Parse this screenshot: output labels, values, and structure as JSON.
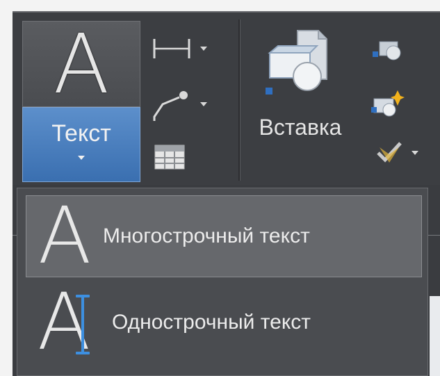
{
  "ribbon": {
    "text_button": {
      "label": "Текст",
      "icon": "large-letter-a-icon",
      "glyph": "A"
    },
    "tools": [
      {
        "name": "dimension",
        "icon": "linear-dimension-icon"
      },
      {
        "name": "leader",
        "icon": "leader-icon"
      },
      {
        "name": "table",
        "icon": "table-icon"
      }
    ],
    "insert_button": {
      "label": "Вставка",
      "icon": "insert-block-icon"
    },
    "block_tools": [
      {
        "name": "create-block",
        "icon": "create-block-icon"
      },
      {
        "name": "edit-block",
        "icon": "edit-block-icon"
      },
      {
        "name": "block-attributes",
        "icon": "block-attributes-icon"
      }
    ]
  },
  "text_menu": {
    "items": [
      {
        "label": "Многострочный текст",
        "icon": "multiline-text-icon",
        "glyph": "A",
        "active": true
      },
      {
        "label": "Однострочный текст",
        "icon": "single-line-text-icon",
        "glyph": "A",
        "active": false
      }
    ]
  },
  "colors": {
    "ribbon_bg": "#3c3e42",
    "accent_blue": "#3a6fb0",
    "menu_highlight": "#66686c"
  }
}
